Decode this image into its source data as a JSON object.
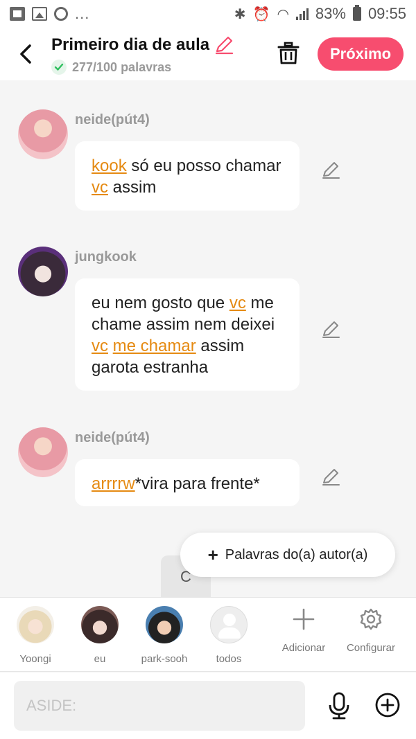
{
  "status_bar": {
    "battery": "83%",
    "time": "09:55",
    "overflow": "..."
  },
  "header": {
    "title": "Primeiro dia de aula",
    "word_count": "277/100 palavras",
    "next_label": "Próximo",
    "accent": "#f74d6f"
  },
  "messages": [
    {
      "author": "neide(pút4)",
      "parts": [
        [
          "kook",
          true
        ],
        [
          " só eu posso chamar ",
          false
        ],
        [
          "vc",
          true
        ],
        [
          " assim",
          false
        ]
      ]
    },
    {
      "author": "jungkook",
      "parts": [
        [
          "eu nem gosto que ",
          false
        ],
        [
          "vc",
          true
        ],
        [
          " me chame assim nem deixei ",
          false
        ],
        [
          "vc",
          true
        ],
        [
          " ",
          false
        ],
        [
          "me chamar",
          true
        ],
        [
          " assim garota estranha",
          false
        ]
      ]
    },
    {
      "author": "neide(pút4)",
      "parts": [
        [
          "arrrrw",
          true
        ],
        [
          "*vira para frente*",
          false
        ]
      ]
    }
  ],
  "highlight_color": "#e58a12",
  "popup": {
    "label": "Palavras do(a) autor(a)",
    "behind_letter": "C"
  },
  "characters": [
    {
      "name": "Yoongi"
    },
    {
      "name": "eu"
    },
    {
      "name": "park-sooh"
    },
    {
      "name": "todos"
    }
  ],
  "tools": {
    "add_label": "Adicionar",
    "settings_label": "Configurar"
  },
  "input": {
    "placeholder": "ASIDE:"
  },
  "icons": [
    "back-arrow-icon",
    "pencil-icon",
    "check-icon",
    "trash-icon",
    "plus-icon",
    "gear-icon",
    "microphone-icon",
    "add-circle-icon"
  ]
}
